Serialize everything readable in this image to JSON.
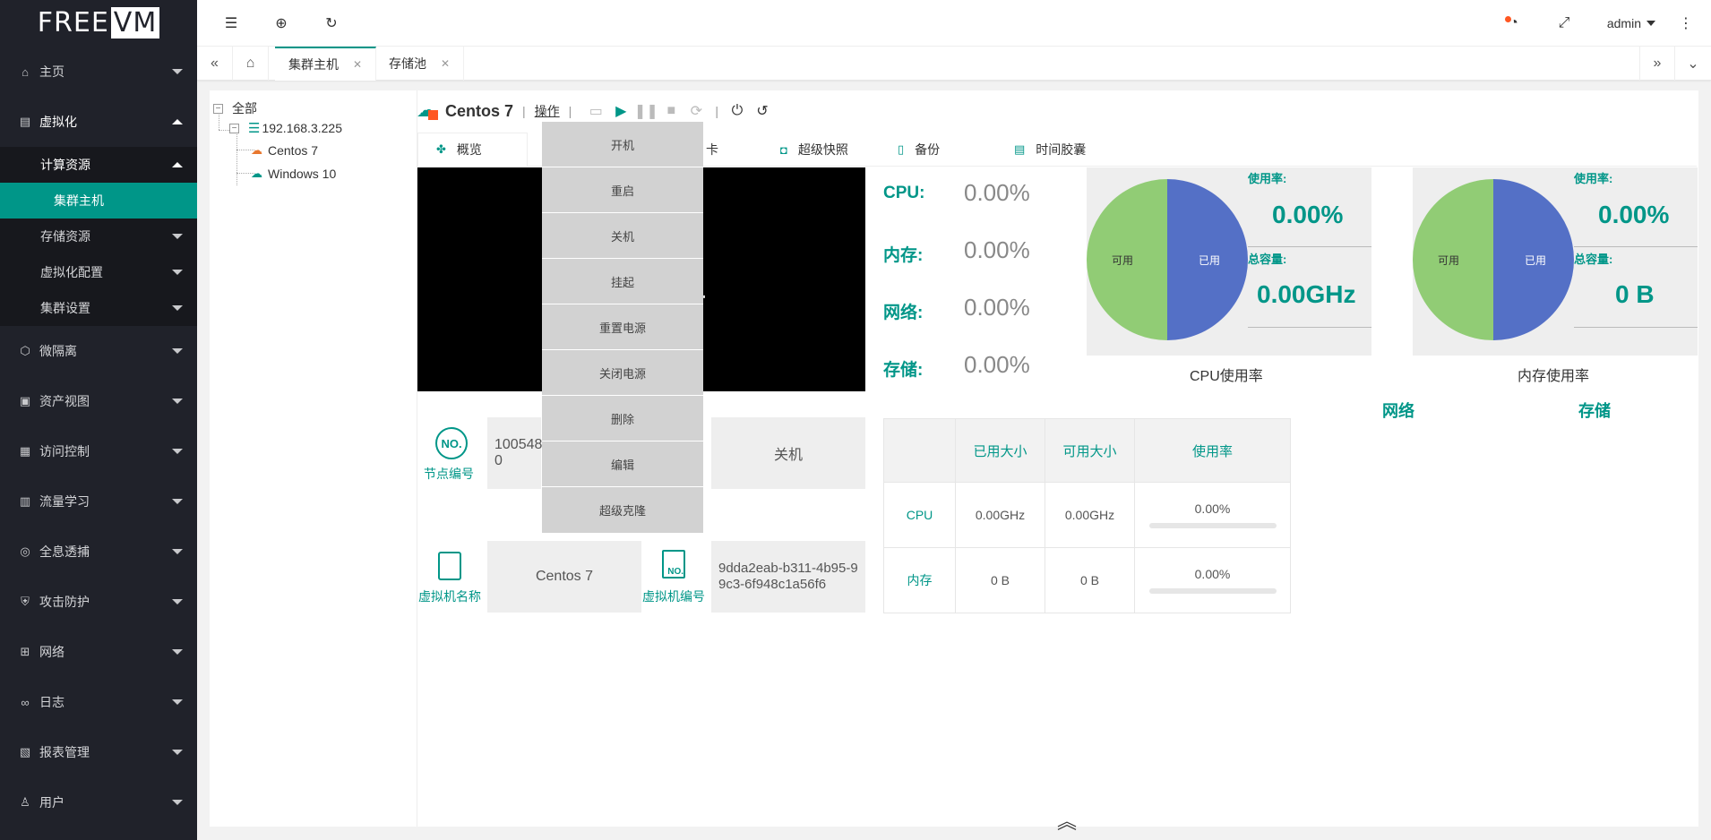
{
  "app": {
    "logo_left": "FREE",
    "logo_right": "VM"
  },
  "colors": {
    "accent": "#009688",
    "sidebar": "#20222a",
    "pie_used": "#5470c6",
    "pie_free": "#91cc75",
    "notify": "#ff5722"
  },
  "sidebar": {
    "items": [
      {
        "label": "主页",
        "icon": "home-icon"
      },
      {
        "label": "虚拟化",
        "icon": "server-icon",
        "open": true
      },
      {
        "label": "微隔离",
        "icon": "cube-icon"
      },
      {
        "label": "资产视图",
        "icon": "assets-icon"
      },
      {
        "label": "访问控制",
        "icon": "grid-icon"
      },
      {
        "label": "流量学习",
        "icon": "traffic-icon"
      },
      {
        "label": "全息透捕",
        "icon": "capture-icon"
      },
      {
        "label": "攻击防护",
        "icon": "shield-icon"
      },
      {
        "label": "网络",
        "icon": "network-icon"
      },
      {
        "label": "日志",
        "icon": "log-icon"
      },
      {
        "label": "报表管理",
        "icon": "report-icon"
      },
      {
        "label": "用户",
        "icon": "user-icon"
      }
    ],
    "sub": {
      "compute": "计算资源",
      "hosts": "集群主机",
      "storage": "存储资源",
      "virt_config": "虚拟化配置",
      "cluster_settings": "集群设置"
    }
  },
  "header": {
    "user": "admin"
  },
  "tabs": [
    {
      "label": "集群主机",
      "active": true
    },
    {
      "label": "存储池",
      "active": false
    }
  ],
  "tree": {
    "root": "全部",
    "host": "192.168.3.225",
    "vms": [
      "Centos 7",
      "Windows 10"
    ]
  },
  "vm": {
    "name": "Centos 7",
    "operate_label": "操作"
  },
  "content_tabs": [
    {
      "label": "概览",
      "active": true
    },
    {
      "label": "卡"
    },
    {
      "label": "超级快照"
    },
    {
      "label": "备份"
    },
    {
      "label": "时间胶囊"
    }
  ],
  "stats": [
    {
      "label": "CPU:",
      "value": "0.00%"
    },
    {
      "label": "内存:",
      "value": "0.00%"
    },
    {
      "label": "网络:",
      "value": "0.00%"
    },
    {
      "label": "存储:",
      "value": "0.00%"
    }
  ],
  "cpu_panel": {
    "usage_label": "使用率:",
    "usage_value": "0.00%",
    "total_label": "总容量:",
    "total_value": "0.00GHz",
    "title": "CPU使用率",
    "free_label": "可用",
    "used_label": "已用"
  },
  "mem_panel": {
    "usage_label": "使用率:",
    "usage_value": "0.00%",
    "total_label": "总容量:",
    "total_value": "0 B",
    "title": "内存使用率",
    "free_label": "可用",
    "used_label": "已用"
  },
  "section_titles": {
    "network": "网络",
    "storage": "存储"
  },
  "info": {
    "node_no_label": "节点编号",
    "node_no_value": "100548\n0",
    "state": "关机",
    "vm_name_label": "虚拟机名称",
    "vm_name_value": "Centos 7",
    "vm_no_label": "虚拟机编号",
    "vm_no_value": "9dda2eab-b311-4b95-99c3-6f948c1a56f6"
  },
  "table": {
    "headers": [
      "",
      "已用大小",
      "可用大小",
      "使用率"
    ],
    "rows": [
      {
        "name": "CPU",
        "used": "0.00GHz",
        "free": "0.00GHz",
        "rate": "0.00%",
        "rate_fraction": 0
      },
      {
        "name": "内存",
        "used": "0 B",
        "free": "0 B",
        "rate": "0.00%",
        "rate_fraction": 0
      }
    ]
  },
  "dropdown": [
    "开机",
    "重启",
    "关机",
    "挂起",
    "重置电源",
    "关闭电源",
    "删除",
    "编辑",
    "超级克隆"
  ]
}
